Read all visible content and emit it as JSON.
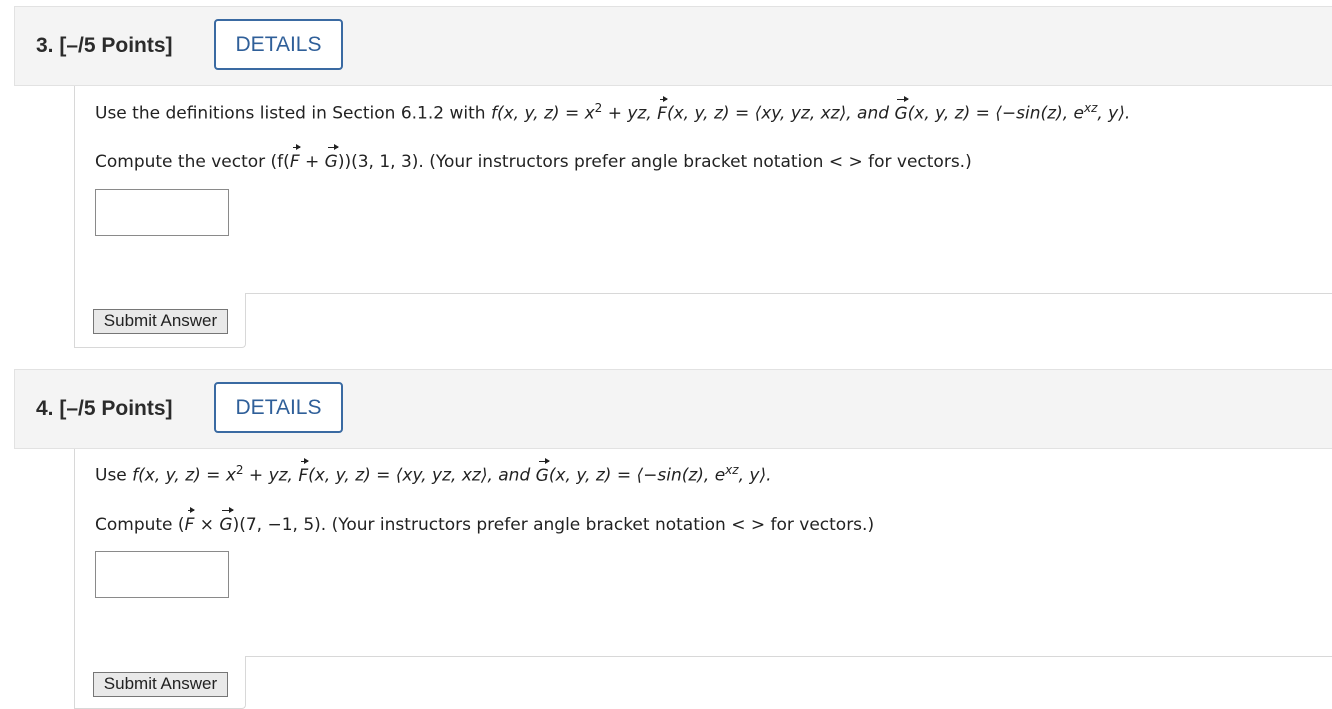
{
  "questions": [
    {
      "number_label": "3. [–/5 Points]",
      "details_label": "DETAILS",
      "line1": {
        "prefix": "Use the definitions listed in Section 6.1.2 with ",
        "f_def": "f(x, y, z) = x",
        "sup": "2",
        "f_def_end": " + yz, ",
        "F": "F",
        "F_def": "(x, y, z) = ⟨xy, yz, xz⟩, and ",
        "G": "G",
        "G_def": "(x, y, z) = ⟨−sin(z), e",
        "G_sup": "xz",
        "G_end": ", y⟩."
      },
      "line2": {
        "a": "Compute the vector (f(",
        "F": "F",
        "b": " + ",
        "G": "G",
        "c": "))(3, 1, 3). (Your instructors prefer angle bracket notation < > for vectors.)"
      },
      "answer_value": "",
      "submit_label": "Submit Answer"
    },
    {
      "number_label": "4. [–/5 Points]",
      "details_label": "DETAILS",
      "line1": {
        "prefix": "Use ",
        "f_def": "f(x, y, z) = x",
        "sup": "2",
        "f_def_end": " + yz, ",
        "F": "F",
        "F_def": "(x, y, z) = ⟨xy, yz, xz⟩, and ",
        "G": "G",
        "G_def": "(x, y, z) = ⟨−sin(z), e",
        "G_sup": "xz",
        "G_end": ", y⟩."
      },
      "line2": {
        "a": "Compute (",
        "F": "F",
        "b": " × ",
        "G": "G",
        "c": ")(7, −1, 5). (Your instructors prefer angle bracket notation < > for vectors.)"
      },
      "answer_value": "",
      "submit_label": "Submit Answer"
    }
  ]
}
